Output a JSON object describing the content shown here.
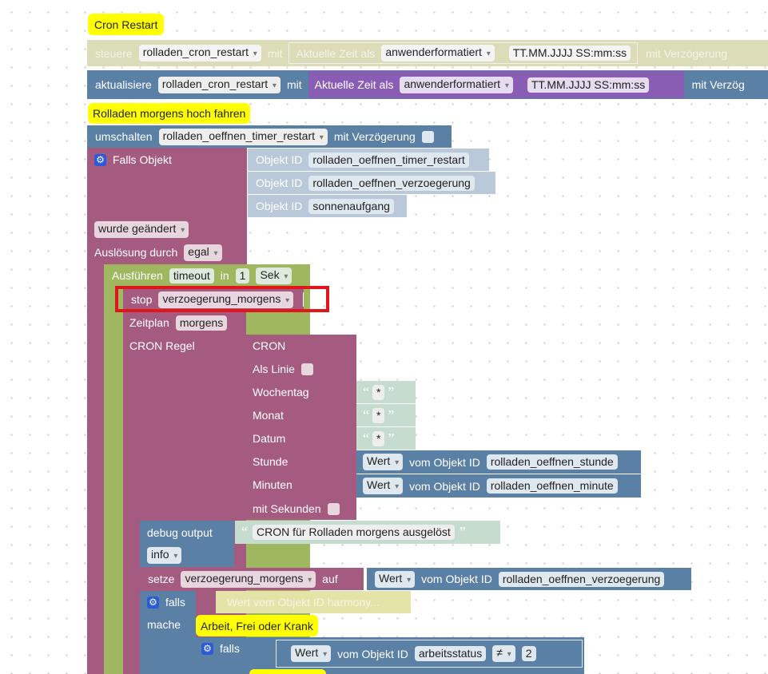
{
  "comment1": "Cron Restart",
  "comment2": "Rolladen morgens hoch fahren",
  "comment3": "Arbeit, Frei oder Krank",
  "steuere": {
    "label": "steuere",
    "var": "rolladen_cron_restart",
    "mit": "mit",
    "zeit": "Aktuelle Zeit als",
    "format": "anwenderformatiert",
    "pattern": "TT.MM.JJJJ SS:mm:ss",
    "verz": "mit Verzögerung"
  },
  "aktualisiere": {
    "label": "aktualisiere",
    "var": "rolladen_cron_restart",
    "mit": "mit",
    "zeit": "Aktuelle Zeit als",
    "format": "anwenderformatiert",
    "pattern": "TT.MM.JJJJ SS:mm:ss",
    "verz": "mit Verzög"
  },
  "umschalten": {
    "label": "umschalten",
    "var": "rolladen_oeffnen_timer_restart",
    "verz": "mit Verzögerung"
  },
  "trigger": {
    "falls": "Falls Objekt",
    "objekt_id": "Objekt ID",
    "ids": [
      "rolladen_oeffnen_timer_restart",
      "rolladen_oeffnen_verzoegerung",
      "sonnenaufgang"
    ],
    "changed": "wurde geändert",
    "ausloesung": "Auslösung durch",
    "egal": "egal"
  },
  "timeout": {
    "label": "Ausführen",
    "var": "timeout",
    "in": "in",
    "value": "1",
    "unit": "Sek"
  },
  "stop": {
    "label": "stop",
    "var": "verzoegerung_morgens"
  },
  "zeitplan": {
    "label": "Zeitplan",
    "var": "morgens"
  },
  "cron": {
    "regel": "CRON Regel",
    "title": "CRON",
    "als_linie": "Als Linie",
    "wochentag": "Wochentag",
    "monat": "Monat",
    "datum": "Datum",
    "stunde": "Stunde",
    "minuten": "Minuten",
    "sekunden": "mit Sekunden",
    "star": "*",
    "wert": "Wert",
    "vom": "vom Objekt ID",
    "stunde_id": "rolladen_oeffnen_stunde",
    "minute_id": "rolladen_oeffnen_minute"
  },
  "debug": {
    "label": "debug output",
    "text": "CRON für Rolladen morgens ausgelöst",
    "level": "info"
  },
  "setze": {
    "label": "setze",
    "var": "verzoegerung_morgens",
    "auf": "auf",
    "wert": "Wert",
    "vom": "vom Objekt ID",
    "id": "rolladen_oeffnen_verzoegerung"
  },
  "falls1": {
    "label": "falls",
    "cond": "Wert vom Objekt ID harmony...",
    "mache": "mache"
  },
  "falls2": {
    "label": "falls",
    "wert": "Wert",
    "vom": "vom Objekt ID",
    "id": "arbeitsstatus",
    "op": "≠",
    "value": "2"
  },
  "colors": {
    "selection": "#e0161d",
    "comment": "#ffff00",
    "olive": "#dcdcb8",
    "blue": "#5b80a5",
    "purple": "#8a5db5",
    "pink": "#a55b80",
    "green": "#9fb85f",
    "text": "#c6dccf"
  }
}
